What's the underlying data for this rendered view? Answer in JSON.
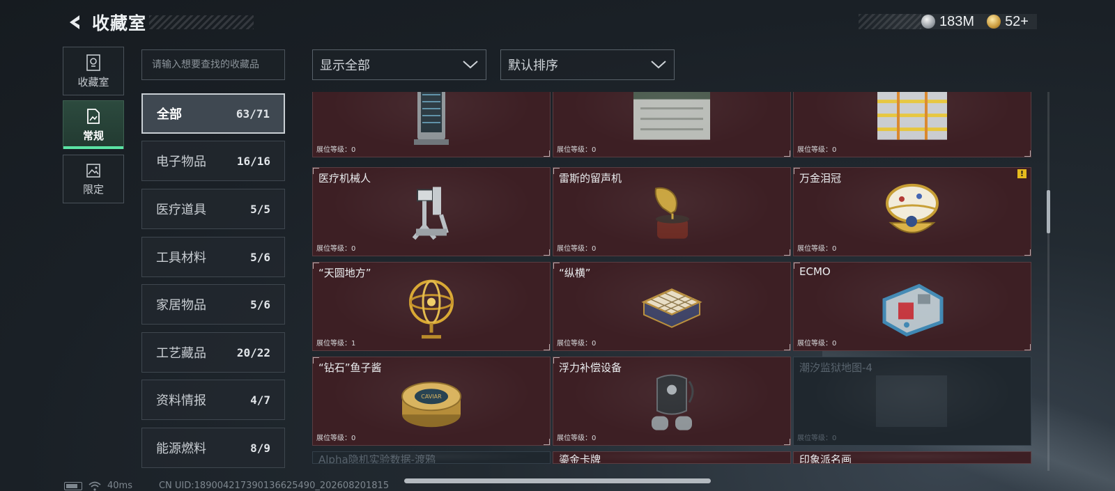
{
  "header": {
    "title": "收藏室",
    "currencies": [
      {
        "icon": "silver-coin-icon",
        "value": "183M"
      },
      {
        "icon": "gold-coin-icon",
        "value": "52+"
      }
    ]
  },
  "mode_tabs": [
    {
      "label": "收藏室",
      "icon": "trophy-icon",
      "active": false
    },
    {
      "label": "常规",
      "icon": "document-icon",
      "active": true
    },
    {
      "label": "限定",
      "icon": "landscape-icon",
      "active": false
    }
  ],
  "search": {
    "placeholder": "请输入想要查找的收藏品",
    "value": ""
  },
  "categories": [
    {
      "name": "全部",
      "count": "63/71",
      "active": true
    },
    {
      "name": "电子物品",
      "count": "16/16"
    },
    {
      "name": "医疗道具",
      "count": "5/5"
    },
    {
      "name": "工具材料",
      "count": "5/6"
    },
    {
      "name": "家居物品",
      "count": "5/6"
    },
    {
      "name": "工艺藏品",
      "count": "20/22"
    },
    {
      "name": "资料情报",
      "count": "4/7"
    },
    {
      "name": "能源燃料",
      "count": "8/9"
    }
  ],
  "filters": {
    "display": "显示全部",
    "sort": "默认排序"
  },
  "items": [
    {
      "name": "",
      "level": "展位等级：0",
      "icon": "server-cabinet-icon"
    },
    {
      "name": "",
      "level": "展位等级：0",
      "icon": "supply-crate-icon"
    },
    {
      "name": "",
      "level": "展位等级：0",
      "icon": "battery-pack-icon"
    },
    {
      "name": "医疗机械人",
      "level": "展位等级：0",
      "icon": "medical-robot-icon"
    },
    {
      "name": "雷斯的留声机",
      "level": "展位等级：0",
      "icon": "gramophone-icon"
    },
    {
      "name": "万金泪冠",
      "level": "展位等级：0",
      "icon": "jeweled-egg-icon",
      "warning": "!"
    },
    {
      "name": "“天圆地方”",
      "level": "展位等级：1",
      "icon": "armillary-sphere-icon"
    },
    {
      "name": "“纵横”",
      "level": "展位等级：0",
      "icon": "chessboard-icon"
    },
    {
      "name": "ECMO",
      "level": "展位等级：0",
      "icon": "ecmo-machine-icon"
    },
    {
      "name": "“钻石”鱼子酱",
      "level": "展位等级：0",
      "icon": "caviar-tin-icon",
      "art_text": "CAVIAR"
    },
    {
      "name": "浮力补偿设备",
      "level": "展位等级：0",
      "icon": "buoyancy-device-icon"
    },
    {
      "name": "潮汐监狱地图-4",
      "level": "展位等级：0",
      "icon": "map-placeholder-icon",
      "locked": true
    },
    {
      "name": "Alpha隐机实验数据-渡鸦",
      "level": "",
      "icon": "",
      "locked": true
    },
    {
      "name": "鎏金卡牌",
      "level": "",
      "icon": ""
    },
    {
      "name": "印象派名画",
      "level": "",
      "icon": ""
    }
  ],
  "status_bar": {
    "ping": "40ms",
    "uid": "CN UID:189004217390136625490_202608201815"
  },
  "colors": {
    "card_bg": "#3d1f24",
    "locked_card_bg": "#1f272e",
    "active_tab_accent": "#5be3a4",
    "warning": "#e6bb1e"
  }
}
